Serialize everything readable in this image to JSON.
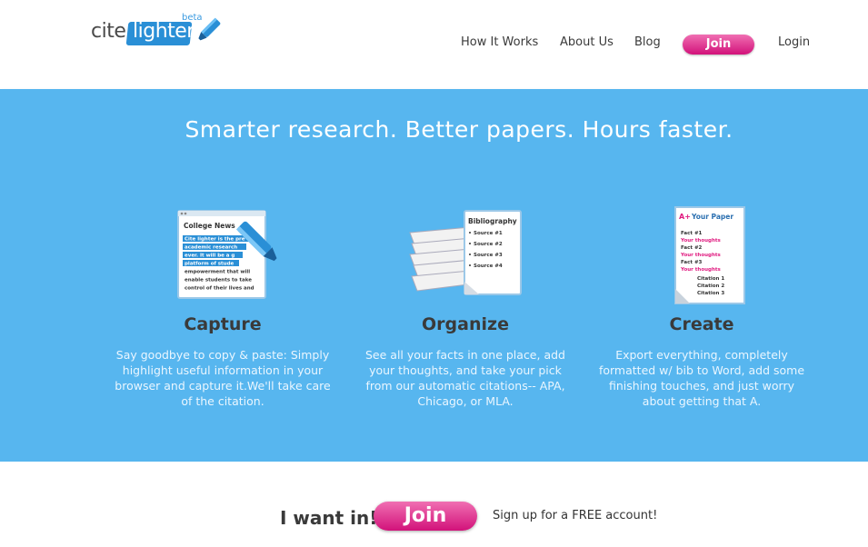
{
  "logo": {
    "cite": "cite",
    "lighter": "lighter",
    "beta": "beta"
  },
  "nav": {
    "how_it_works": "How It Works",
    "about_us": "About Us",
    "blog": "Blog",
    "join": "Join",
    "login": "Login"
  },
  "hero": {
    "title": "Smarter research. Better papers. Hours faster."
  },
  "features": [
    {
      "title": "Capture",
      "description": "Say goodbye to copy & paste: Simply highlight useful information in your browser and capture it.We'll take care of the citation.",
      "icon": "highlighted-article-icon",
      "icon_text": {
        "heading": "College News",
        "lines": [
          "Cite lighter is the pre",
          "academic research",
          "ever. It will be a g",
          "platform of stude",
          "empowerment that will",
          "enable students to take",
          "control of their lives and"
        ]
      }
    },
    {
      "title": "Organize",
      "description": "See all your facts in one place, add your thoughts, and take your pick from our automatic citations-- APA, Chicago, or MLA.",
      "icon": "bibliography-stack-icon",
      "icon_text": {
        "heading": "Bibliography",
        "lines": [
          "Source #1",
          "Source #2",
          "Source #3",
          "Source #4"
        ]
      }
    },
    {
      "title": "Create",
      "description": "Export everything, completely formatted w/ bib to Word, add some finishing touches, and just worry about getting that A.",
      "icon": "paper-document-icon",
      "icon_text": {
        "grade": "A+",
        "heading": "Your Paper",
        "lines": [
          "Fact #1",
          "Your thoughts",
          "Fact #2",
          "Your thoughts",
          "Fact #3",
          "Your thoughts",
          "Citation 1",
          "Citation 2",
          "Citation 3"
        ]
      }
    }
  ],
  "cta": {
    "want_in": "I want in!",
    "join": "Join",
    "signup": "Sign up for a FREE account!"
  },
  "colors": {
    "hero_bg": "#57b6ef",
    "join_pink": "#d2127a",
    "logo_blue": "#2a8fd6"
  }
}
